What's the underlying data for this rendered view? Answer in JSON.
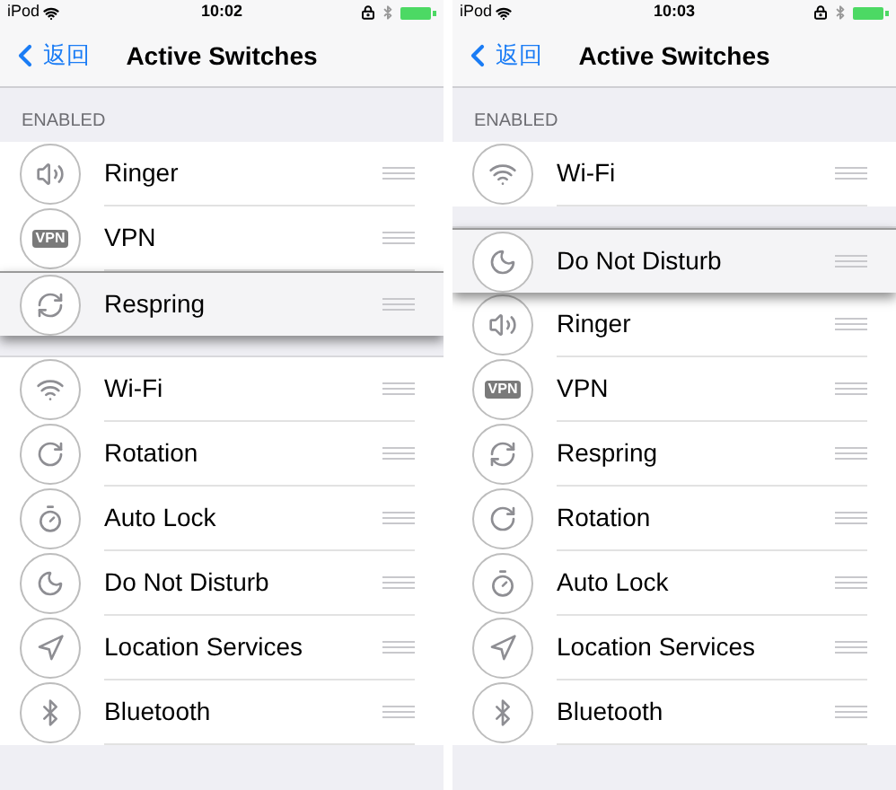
{
  "screens": [
    {
      "status_bar": {
        "carrier": "iPod",
        "time": "10:02"
      },
      "nav": {
        "back": "返回",
        "title": "Active Switches"
      },
      "section": "ENABLED",
      "rows": [
        {
          "kind": "speaker",
          "label": "Ringer",
          "dragging": false
        },
        {
          "kind": "vpn",
          "label": "VPN",
          "badge": "VPN",
          "dragging": false
        },
        {
          "kind": "respring",
          "label": "Respring",
          "dragging": true
        },
        {
          "kind": "gap"
        },
        {
          "kind": "wifi",
          "label": "Wi-Fi",
          "dragging": false
        },
        {
          "kind": "rotation",
          "label": "Rotation",
          "dragging": false
        },
        {
          "kind": "timer",
          "label": "Auto Lock",
          "dragging": false
        },
        {
          "kind": "moon",
          "label": "Do Not Disturb",
          "dragging": false
        },
        {
          "kind": "location",
          "label": "Location Services",
          "dragging": false
        },
        {
          "kind": "bluetooth",
          "label": "Bluetooth",
          "dragging": false
        }
      ]
    },
    {
      "status_bar": {
        "carrier": "iPod",
        "time": "10:03"
      },
      "nav": {
        "back": "返回",
        "title": "Active Switches"
      },
      "section": "ENABLED",
      "rows": [
        {
          "kind": "wifi",
          "label": "Wi-Fi",
          "dragging": false
        },
        {
          "kind": "gap"
        },
        {
          "kind": "moon",
          "label": "Do Not Disturb",
          "dragging": true
        },
        {
          "kind": "speaker",
          "label": "Ringer",
          "dragging": false
        },
        {
          "kind": "vpn",
          "label": "VPN",
          "badge": "VPN",
          "dragging": false
        },
        {
          "kind": "respring",
          "label": "Respring",
          "dragging": false
        },
        {
          "kind": "rotation",
          "label": "Rotation",
          "dragging": false
        },
        {
          "kind": "timer",
          "label": "Auto Lock",
          "dragging": false
        },
        {
          "kind": "location",
          "label": "Location Services",
          "dragging": false
        },
        {
          "kind": "bluetooth",
          "label": "Bluetooth",
          "dragging": false
        }
      ]
    }
  ]
}
